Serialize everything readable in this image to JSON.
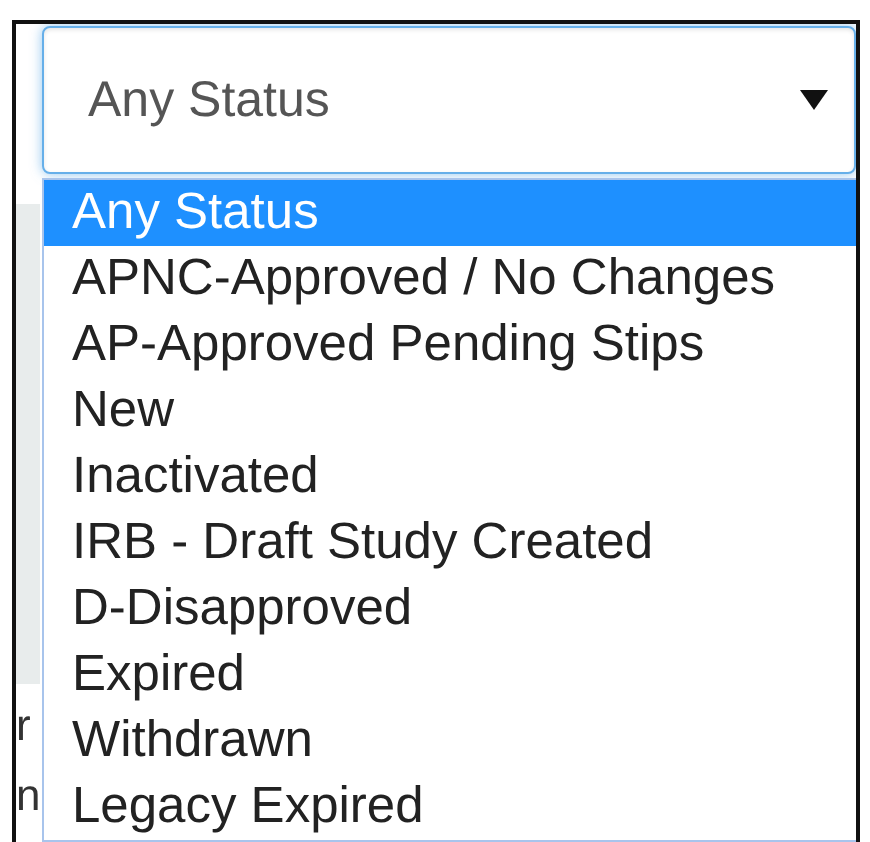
{
  "select": {
    "value": "Any Status",
    "expanded": true
  },
  "options": [
    {
      "label": "Any Status",
      "selected": true
    },
    {
      "label": "APNC-Approved / No Changes",
      "selected": false
    },
    {
      "label": "AP-Approved Pending Stips",
      "selected": false
    },
    {
      "label": "New",
      "selected": false
    },
    {
      "label": "Inactivated",
      "selected": false
    },
    {
      "label": "IRB - Draft Study Created",
      "selected": false
    },
    {
      "label": "D-Disapproved",
      "selected": false
    },
    {
      "label": "Expired",
      "selected": false
    },
    {
      "label": "Withdrawn",
      "selected": false
    },
    {
      "label": "Legacy Expired",
      "selected": false
    }
  ],
  "background_fragments": [
    "r",
    "n"
  ]
}
